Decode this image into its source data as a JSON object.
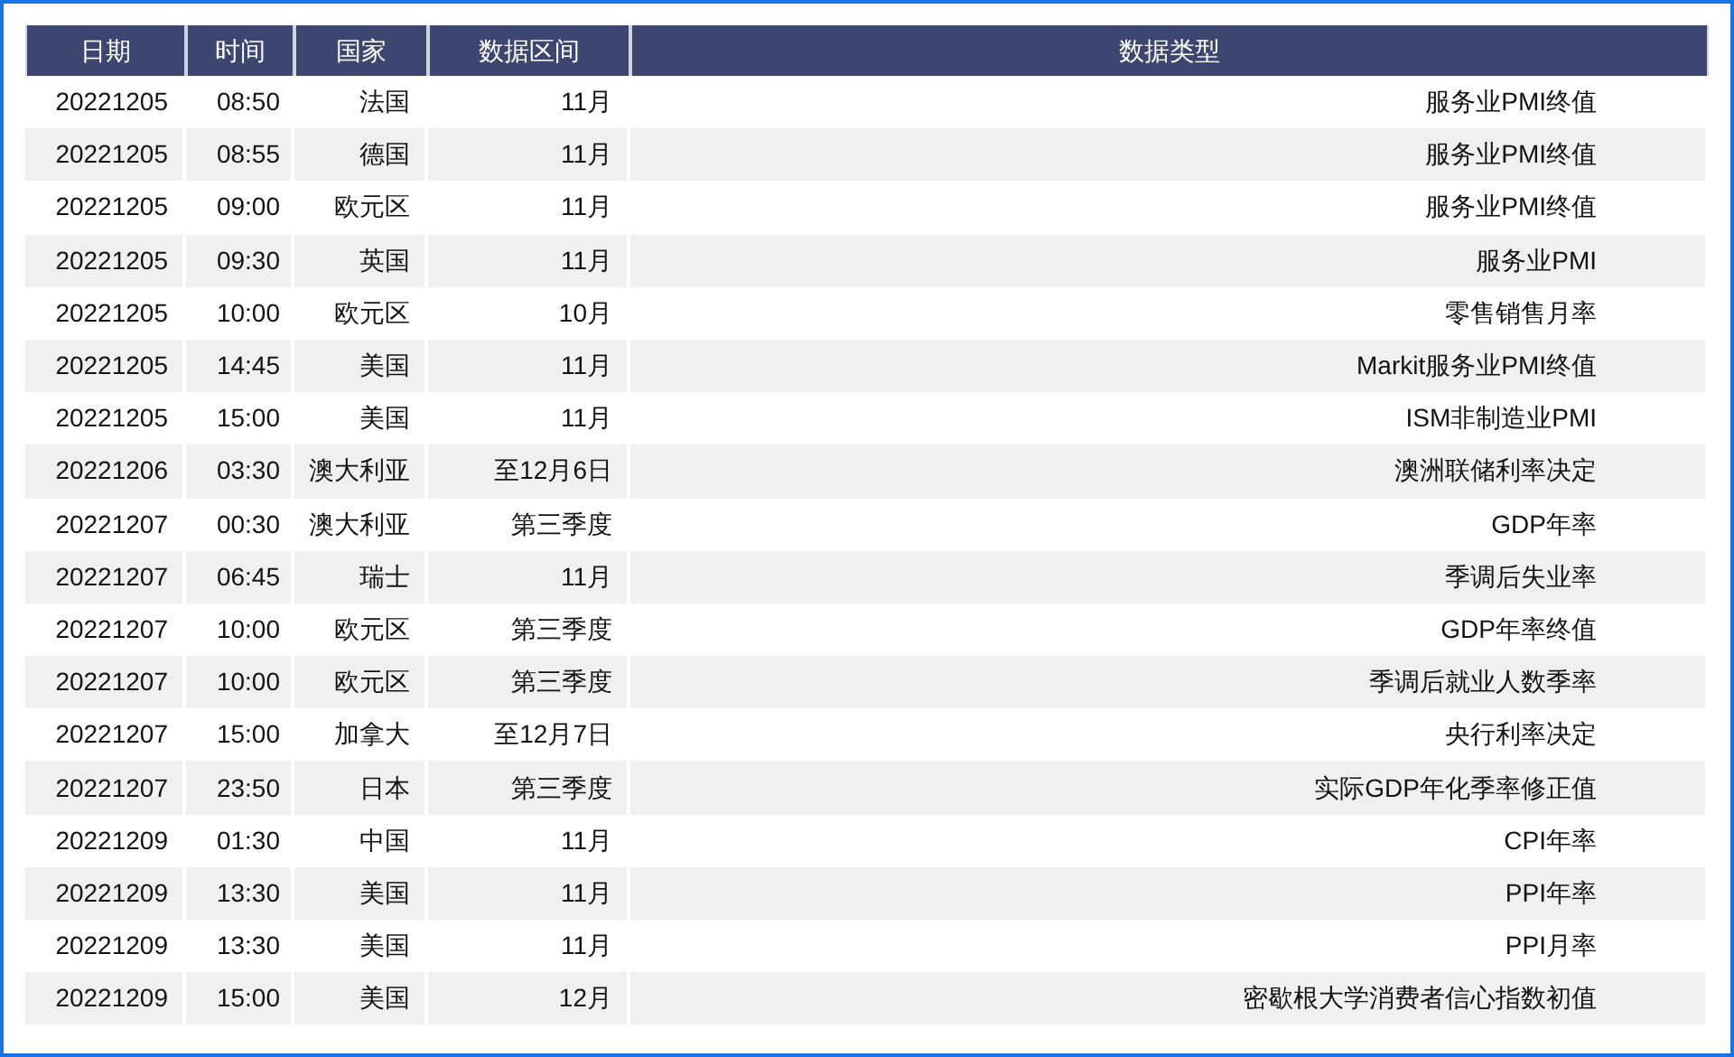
{
  "table": {
    "columns": [
      "日期",
      "时间",
      "国家",
      "数据区间",
      "数据类型"
    ],
    "rows": [
      [
        "20221205",
        "08:50",
        "法国",
        "11月",
        "服务业PMI终值"
      ],
      [
        "20221205",
        "08:55",
        "德国",
        "11月",
        "服务业PMI终值"
      ],
      [
        "20221205",
        "09:00",
        "欧元区",
        "11月",
        "服务业PMI终值"
      ],
      [
        "20221205",
        "09:30",
        "英国",
        "11月",
        "服务业PMI"
      ],
      [
        "20221205",
        "10:00",
        "欧元区",
        "10月",
        "零售销售月率"
      ],
      [
        "20221205",
        "14:45",
        "美国",
        "11月",
        "Markit服务业PMI终值"
      ],
      [
        "20221205",
        "15:00",
        "美国",
        "11月",
        "ISM非制造业PMI"
      ],
      [
        "20221206",
        "03:30",
        "澳大利亚",
        "至12月6日",
        "澳洲联储利率决定"
      ],
      [
        "20221207",
        "00:30",
        "澳大利亚",
        "第三季度",
        "GDP年率"
      ],
      [
        "20221207",
        "06:45",
        "瑞士",
        "11月",
        "季调后失业率"
      ],
      [
        "20221207",
        "10:00",
        "欧元区",
        "第三季度",
        "GDP年率终值"
      ],
      [
        "20221207",
        "10:00",
        "欧元区",
        "第三季度",
        "季调后就业人数季率"
      ],
      [
        "20221207",
        "15:00",
        "加拿大",
        "至12月7日",
        "央行利率决定"
      ],
      [
        "20221207",
        "23:50",
        "日本",
        "第三季度",
        "实际GDP年化季率修正值"
      ],
      [
        "20221209",
        "01:30",
        "中国",
        "11月",
        "CPI年率"
      ],
      [
        "20221209",
        "13:30",
        "美国",
        "11月",
        "PPI年率"
      ],
      [
        "20221209",
        "13:30",
        "美国",
        "11月",
        "PPI月率"
      ],
      [
        "20221209",
        "15:00",
        "美国",
        "12月",
        "密歇根大学消费者信心指数初值"
      ]
    ]
  }
}
